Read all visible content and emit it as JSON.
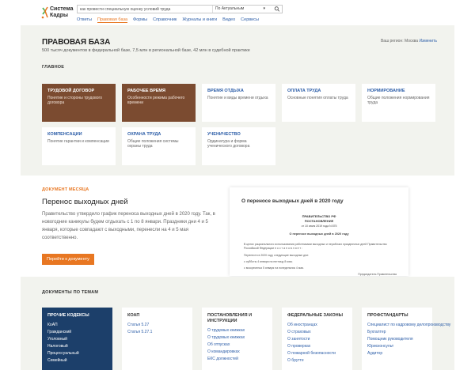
{
  "header": {
    "logo_line1": "Система",
    "logo_line2": "Кадры",
    "search_value": "как провести специальную оценку условий труда",
    "search_scope": "По Актуальным",
    "nav": [
      "Ответы",
      "Правовая база",
      "Формы",
      "Справочник",
      "Журналы и книги",
      "Видео",
      "Сервисы"
    ],
    "nav_active_index": 1
  },
  "hero": {
    "title": "ПРАВОВАЯ БАЗА",
    "subtitle": "500 тысяч документов в федеральной базе, 7,5 млн в региональной базе, 42 млн в судебной практике",
    "region_prefix": "Ваш регион: Москва",
    "region_link": "Изменить",
    "section_label": "ГЛАВНОЕ",
    "cards": [
      {
        "title": "ТРУДОВОЙ ДОГОВОР",
        "desc": "Понятие и стороны трудового договора",
        "dark": true
      },
      {
        "title": "РАБОЧЕЕ ВРЕМЯ",
        "desc": "Особенности режима рабочего времени",
        "dark": true
      },
      {
        "title": "ВРЕМЯ ОТДЫХА",
        "desc": "Понятие и виды времени отдыха",
        "dark": false
      },
      {
        "title": "ОПЛАТА ТРУДА",
        "desc": "Основные понятия оплаты труда",
        "dark": false
      },
      {
        "title": "НОРМИРОВАНИЕ",
        "desc": "Общие положения нормирования труда",
        "dark": false
      },
      {
        "title": "КОМПЕНСАЦИИ",
        "desc": "Понятие гарантии и компенсации",
        "dark": false
      },
      {
        "title": "ОХРАНА ТРУДА",
        "desc": "Общие положения системы охраны труда",
        "dark": false
      },
      {
        "title": "УЧЕНИЧЕСТВО",
        "desc": "Ординатура и форма ученического договора",
        "dark": false
      }
    ]
  },
  "month": {
    "label": "ДОКУМЕНТ МЕСЯЦА",
    "title": "Перенос выходных дней",
    "text": "Правительство утвердило график переноса выходных дней в 2020 году. Так, в новогодние каникулы будем отдыхать с 1 по 8 январи. Праздники дни 4 и 5 января, которые совпадают с выходными, перенесли на 4 и 5 мая соответственно.",
    "button": "Перейти к документу",
    "preview": {
      "title": "О переносе выходных дней в 2020 году",
      "org": "ПРАВИТЕЛЬСТВО РФ",
      "kind": "ПОСТАНОВЛЕНИЕ",
      "date": "от 10 июля 2019 года N 875",
      "subject": "О переносе выходных дней в 2020 году",
      "lines": [
        "В целях рационального использования работниками выходных и нерабочих праздничных дней Правительство Российской Федерации п о с т а н о в л я е т :",
        "Перенести в 2020 году следующие выходные дни:",
        "с субботы 4 января на пятницу 8 мая;",
        "с воскресенья 5 января на понедельник 4 мая."
      ],
      "sign": "Председатель Правительства"
    }
  },
  "topics": {
    "label": "ДОКУМЕНТЫ ПО ТЕМАМ",
    "columns": [
      {
        "title": "ПРОЧИЕ КОДЕКСЫ",
        "dark": true,
        "links": [
          "КоАП",
          "Гражданский",
          "Уголовный",
          "Налоговый",
          "Процессуальный",
          "Семейный"
        ]
      },
      {
        "title": "КОАП",
        "dark": false,
        "links": [
          "Статья 5.27",
          "Статья 5.27.1"
        ]
      },
      {
        "title": "ПОСТАНОВЛЕНИЯ И ИНСТРУКЦИИ",
        "dark": false,
        "links": [
          "О трудовых книжках",
          "О трудовых книжках",
          "Об отпусках",
          "О командировках",
          "ЕКС должностей"
        ]
      },
      {
        "title": "ФЕДЕРАЛЬНЫЕ ЗАКОНЫ",
        "dark": false,
        "links": [
          "Об иностранцах",
          "О страховых",
          "О занятости",
          "О проверках",
          "О пожарной безопасности",
          "О брутте"
        ]
      },
      {
        "title": "ПРОФСТАНДАРТЫ",
        "dark": false,
        "links": [
          "Специалист по кадровому делопроизводству",
          "Бухгалтер",
          "Помощник руководителя",
          "Юрисконсульт",
          "Аудитор"
        ]
      }
    ]
  }
}
